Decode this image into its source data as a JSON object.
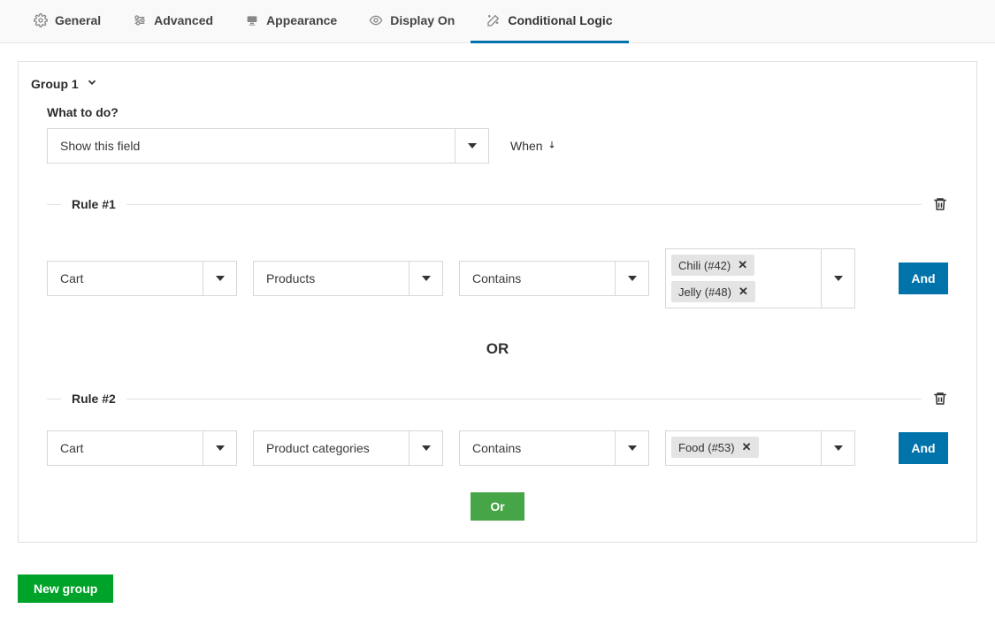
{
  "tabs": [
    {
      "icon": "gear",
      "label": "General"
    },
    {
      "icon": "sliders",
      "label": "Advanced"
    },
    {
      "icon": "monitor",
      "label": "Appearance"
    },
    {
      "icon": "eye",
      "label": "Display On"
    },
    {
      "icon": "wand",
      "label": "Conditional Logic"
    }
  ],
  "active_tab_index": 4,
  "group": {
    "title": "Group 1",
    "what_label": "What to do?",
    "action_value": "Show this field",
    "when_label": "When",
    "rules": [
      {
        "title": "Rule #1",
        "source": "Cart",
        "field": "Products",
        "operator": "Contains",
        "tags": [
          "Chili (#42)",
          "Jelly (#48)"
        ],
        "and_label": "And"
      },
      {
        "title": "Rule #2",
        "source": "Cart",
        "field": "Product categories",
        "operator": "Contains",
        "tags": [
          "Food (#53)"
        ],
        "and_label": "And"
      }
    ],
    "or_separator": "OR",
    "or_button": "Or"
  },
  "new_group_label": "New group"
}
